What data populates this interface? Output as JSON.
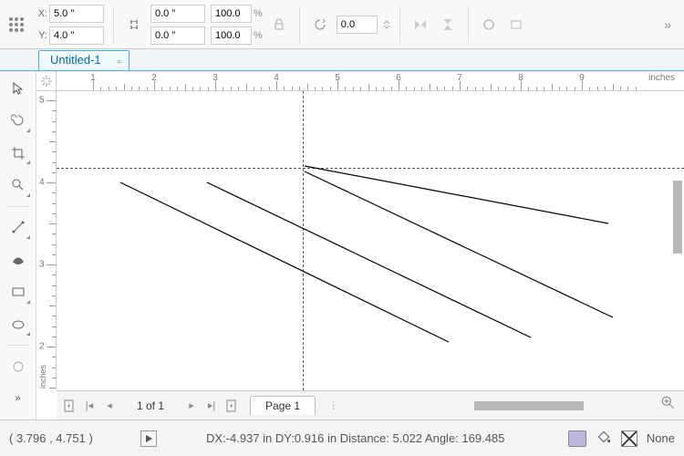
{
  "propbar": {
    "x_label": "X:",
    "y_label": "Y:",
    "x_value": "5.0 \"",
    "y_value": "4.0 \"",
    "w_value": "0.0 \"",
    "h_value": "0.0 \"",
    "scale_x": "100.0",
    "scale_y": "100.0",
    "pct": "%",
    "rotation": "0.0"
  },
  "doc_tab": {
    "title": "Untitled-1"
  },
  "ruler": {
    "unit": "inches",
    "h_marks": [
      1,
      2,
      3,
      4,
      5,
      6,
      7,
      8,
      9
    ],
    "v_marks": [
      5,
      4,
      3,
      2
    ]
  },
  "page_nav": {
    "counter": "1 of 1",
    "page_label": "Page 1"
  },
  "status": {
    "coords": "( 3.796 , 4.751  )",
    "info": "DX:-4.937 in DY:0.916 in Distance: 5.022 Angle: 169.485",
    "fill": "None"
  }
}
